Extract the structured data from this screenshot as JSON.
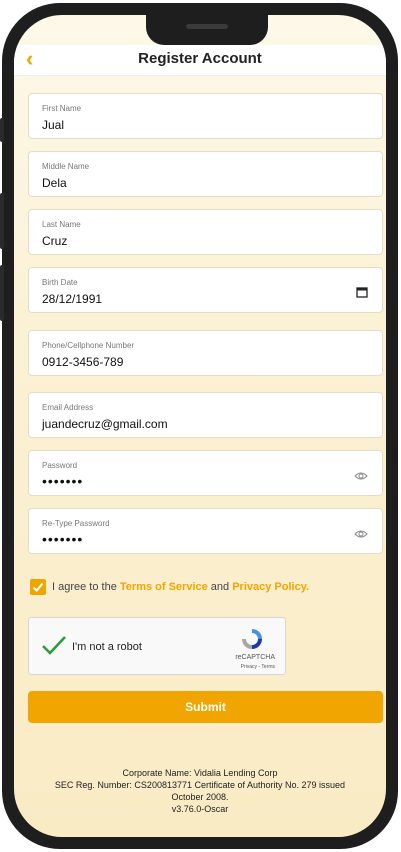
{
  "header": {
    "back_icon": "chevron-left-icon",
    "title": "Register Account"
  },
  "form": {
    "first_name": {
      "label": "First Name",
      "value": "Jual"
    },
    "middle_name": {
      "label": "Middle Name",
      "value": "Dela"
    },
    "last_name": {
      "label": "Last Name",
      "value": "Cruz"
    },
    "birth_date": {
      "label": "Birth Date",
      "value": "28/12/1991"
    },
    "phone": {
      "label": "Phone/Cellphone Number",
      "value": "0912-3456-789"
    },
    "email": {
      "label": "Email Address",
      "value": "juandecruz@gmail.com"
    },
    "password": {
      "label": "Password",
      "value": "•••••••"
    },
    "retype_password": {
      "label": "Re-Type Password",
      "value": "•••••••"
    }
  },
  "agreement": {
    "prefix": "I agree to the ",
    "terms": "Terms of Service",
    "and": " and ",
    "privacy": "Privacy Policy."
  },
  "captcha": {
    "label": "I'm not a robot",
    "brand": "reCAPTCHA",
    "links": "Privacy - Terms"
  },
  "submit_label": "Submit",
  "footer": {
    "line1": "Corporate Name: Vidalia Lending Corp",
    "line2": "SEC Reg. Number: CS200813771 Certificate of Authority No. 279 issued",
    "line3": "October 2008.",
    "version": "v3.76.0-Oscar"
  },
  "colors": {
    "accent": "#f0a500",
    "background": "#fbf1d4"
  }
}
